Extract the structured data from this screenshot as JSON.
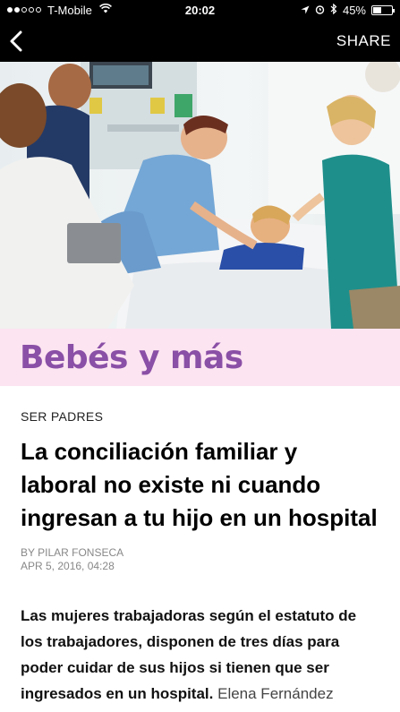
{
  "status_bar": {
    "carrier": "T-Mobile",
    "time": "20:02",
    "battery": "45%",
    "battery_level": 0.45
  },
  "nav": {
    "share_label": "SHARE"
  },
  "brand": {
    "name": "Bebés y más"
  },
  "article": {
    "section": "SER PADRES",
    "headline": "La conciliación familiar y laboral no existe ni cuando ingresan a tu hijo en un hospital",
    "author": "BY PILAR FONSECA",
    "date": "APR 5, 2016, 04:28",
    "lead": "Las mujeres trabajadoras según el estatuto de los trabajadores, disponen de tres días para poder cuidar de sus hijos si tienen que ser ingresados en un hospital.",
    "lead_continuation": "Elena Fernández"
  }
}
